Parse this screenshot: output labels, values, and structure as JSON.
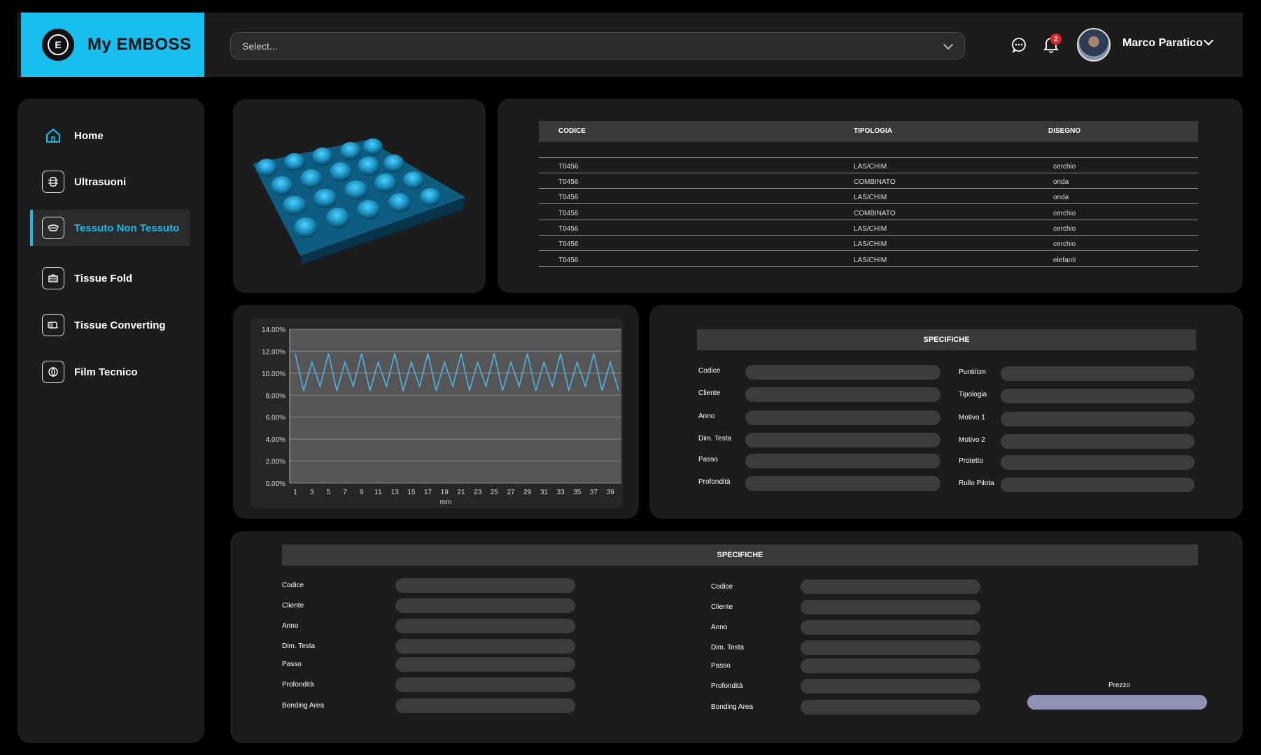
{
  "app": {
    "name": "My EMBOSS",
    "logo_letter": "E",
    "accent": "#16bfee"
  },
  "header": {
    "select_placeholder": "Select...",
    "notifications_count": "2",
    "user_name": "Marco Paratico"
  },
  "sidebar": {
    "items": [
      {
        "label": "Home",
        "icon": "home-icon"
      },
      {
        "label": "Ultrasuoni",
        "icon": "ultrasound-icon"
      },
      {
        "label": "Tessuto Non Tessuto",
        "icon": "nonwoven-icon",
        "active": true
      },
      {
        "label": "Tissue Fold",
        "icon": "tissue-fold-icon"
      },
      {
        "label": "Tissue Converting",
        "icon": "tissue-converting-icon"
      },
      {
        "label": "Film Tecnico",
        "icon": "film-icon"
      }
    ]
  },
  "table": {
    "headers": [
      "CODICE",
      "TIPOLOGIA",
      "DISEGNO"
    ],
    "rows": [
      [
        "T0456",
        "LAS/CHIM",
        "cerchio"
      ],
      [
        "T0456",
        "COMBINATO",
        "onda"
      ],
      [
        "T0456",
        "LAS/CHIM",
        "onda"
      ],
      [
        "T0456",
        "COMBINATO",
        "cerchio"
      ],
      [
        "T0456",
        "LAS/CHIM",
        "cerchio"
      ],
      [
        "T0456",
        "LAS/CHIM",
        "cerchio"
      ],
      [
        "T0456",
        "LAS/CHIM",
        "elefanti"
      ]
    ]
  },
  "specs_right": {
    "title": "SPECIFICHE",
    "left_labels": [
      "Codice",
      "Cliente",
      "Anno",
      "Dim. Testa",
      "Passo",
      "Profondità"
    ],
    "right_labels": [
      "Punti/cm",
      "Tipologia",
      "Motivo 1",
      "Motivo 2",
      "Protetto",
      "Rullo Pilota"
    ]
  },
  "specs_bottom": {
    "title": "SPECIFICHE",
    "col1_labels": [
      "Codice",
      "Cliente",
      "Anno",
      "Dim. Testa",
      "Passo",
      "Profondità",
      "Bonding Area"
    ],
    "col2_labels": [
      "Codice",
      "Cliente",
      "Anno",
      "Dim. Testa",
      "Passo",
      "Profondità",
      "Bonding Area"
    ],
    "price_label": "Prezzo"
  },
  "chart_data": {
    "type": "line",
    "xlabel": "mm",
    "ylabel": "",
    "ylim": [
      0,
      14
    ],
    "y_ticks": [
      "0.00%",
      "2.00%",
      "4.00%",
      "6.00%",
      "8.00%",
      "10.00%",
      "12.00%",
      "14.00%"
    ],
    "x_tick_labels": [
      "1",
      "3",
      "5",
      "7",
      "9",
      "11",
      "13",
      "15",
      "17",
      "19",
      "21",
      "23",
      "25",
      "27",
      "29",
      "31",
      "33",
      "35",
      "37",
      "39"
    ],
    "x": [
      1,
      2,
      3,
      4,
      5,
      6,
      7,
      8,
      9,
      10,
      11,
      12,
      13,
      14,
      15,
      16,
      17,
      18,
      19,
      20,
      21,
      22,
      23,
      24,
      25,
      26,
      27,
      28,
      29,
      30,
      31,
      32,
      33,
      34,
      35,
      36,
      37,
      38,
      39,
      40
    ],
    "series": [
      {
        "values": [
          11.8,
          8.4,
          11.0,
          8.8,
          11.8,
          8.4,
          11.0,
          8.8,
          11.8,
          8.4,
          11.0,
          8.8,
          11.8,
          8.4,
          11.0,
          8.8,
          11.8,
          8.4,
          11.0,
          8.8,
          11.8,
          8.4,
          11.0,
          8.8,
          11.8,
          8.4,
          11.0,
          8.8,
          11.8,
          8.4,
          11.0,
          8.8,
          11.8,
          8.4,
          11.0,
          8.8,
          11.8,
          8.4,
          11.0,
          8.4
        ],
        "color": "#4fb4e6"
      }
    ],
    "grid": true
  }
}
